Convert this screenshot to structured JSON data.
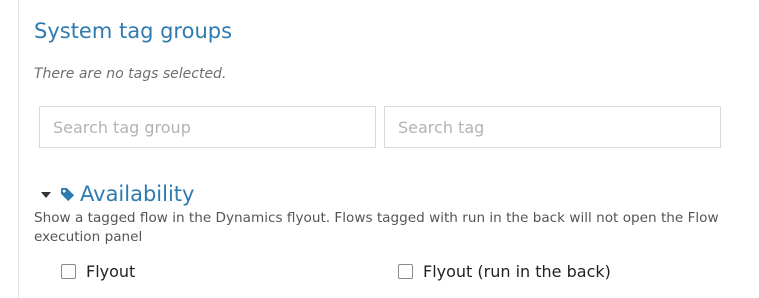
{
  "section": {
    "title": "System tag groups",
    "empty_note": "There are no tags selected."
  },
  "search": {
    "group_placeholder": "Search tag group",
    "tag_placeholder": "Search tag"
  },
  "groups": [
    {
      "name": "Availability",
      "icon": "tag-icon",
      "expanded": true,
      "description": "Show a tagged flow in the Dynamics flyout. Flows tagged with run in the back will not open the Flow execution panel",
      "tags": [
        {
          "label": "Flyout",
          "checked": false
        },
        {
          "label": "Flyout (run in the back)",
          "checked": false
        }
      ]
    }
  ],
  "colors": {
    "accent": "#2e7bb0",
    "border": "#d9d9d9"
  }
}
